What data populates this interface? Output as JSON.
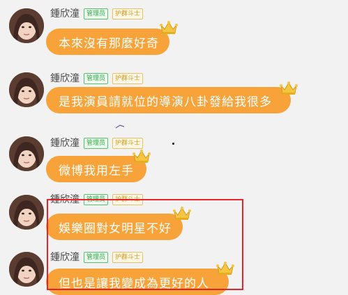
{
  "messages": [
    {
      "username": "鍾欣潼",
      "badges": [
        "管理员",
        "护群斗士"
      ],
      "text": "本來沒有那麼好奇",
      "avatar": "avatar-icon",
      "crown": "crown-icon"
    },
    {
      "username": "鍾欣潼",
      "badges": [
        "管理员",
        "护群斗士"
      ],
      "text": "是我演員請就位的導演八卦發給我很多",
      "avatar": "avatar-icon",
      "crown": "crown-icon"
    },
    {
      "username": "鍾欣潼",
      "badges": [
        "管理员",
        "护群斗士"
      ],
      "text": "微博我用左手",
      "avatar": "avatar-icon",
      "crown": "crown-icon"
    },
    {
      "username": "鍾欣潼",
      "badges": [
        "管理员",
        "护群斗士"
      ],
      "text": "娛樂圈對女明星不好",
      "avatar": "avatar-icon",
      "crown": "crown-icon"
    },
    {
      "username": "鍾欣潼",
      "badges": [
        "管理员",
        "护群斗士"
      ],
      "text": "但也是讓我變成為更好的人",
      "avatar": "avatar-icon",
      "crown": "crown-icon"
    }
  ],
  "colors": {
    "background": "#f2f2f2",
    "bubble": "#f7a33a",
    "bubble_text": "#ffffff",
    "admin_badge": "#2faa45",
    "guard_badge": "#d39a1a",
    "highlight": "#e8232b"
  }
}
